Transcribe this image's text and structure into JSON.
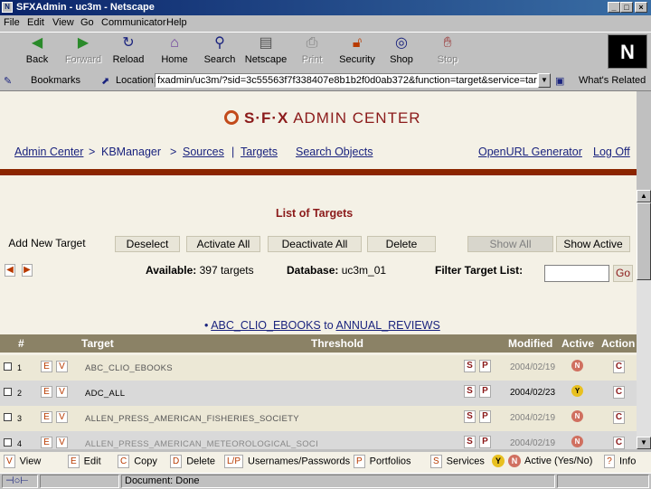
{
  "window": {
    "title": "SFXAdmin - uc3m - Netscape"
  },
  "menu": [
    "File",
    "Edit",
    "View",
    "Go",
    "Communicator",
    "Help"
  ],
  "toolbar": [
    {
      "label": "Back",
      "icon": "back-arrow-icon"
    },
    {
      "label": "Forward",
      "icon": "forward-arrow-icon",
      "disabled": true
    },
    {
      "label": "Reload",
      "icon": "reload-icon"
    },
    {
      "label": "Home",
      "icon": "home-icon"
    },
    {
      "label": "Search",
      "icon": "search-icon"
    },
    {
      "label": "Netscape",
      "icon": "netscape-icon"
    },
    {
      "label": "Print",
      "icon": "print-icon",
      "disabled": true
    },
    {
      "label": "Security",
      "icon": "lock-icon"
    },
    {
      "label": "Shop",
      "icon": "shop-icon"
    },
    {
      "label": "Stop",
      "icon": "stop-icon",
      "disabled": true
    }
  ],
  "brand_logo": "N",
  "locationbar": {
    "bookmarks": "Bookmarks",
    "location_label": "Location:",
    "url": "fxadmin/uc3m/?sid=3c55563f7f338407e8b1b2f0d0ab372&function=target&service=target_parent",
    "whats_related": "What's Related"
  },
  "header": {
    "logo_sfx": "S·F·X",
    "logo_rest": "ADMIN CENTER",
    "nav": [
      {
        "text": "Admin Center",
        "link": true
      },
      {
        "text": ">",
        "link": false
      },
      {
        "text": "KBManager",
        "link": false
      },
      {
        "text": ">",
        "link": false
      },
      {
        "text": "Sources",
        "link": true
      },
      {
        "text": "|",
        "link": false
      },
      {
        "text": "Targets",
        "link": true
      },
      {
        "text": "Search Objects",
        "link": true
      },
      {
        "text": "OpenURL Generator",
        "link": true
      },
      {
        "text": "Log Off",
        "link": true
      }
    ]
  },
  "list_title": "List of Targets",
  "actions": {
    "add_new": "Add New Target",
    "deselect": "Deselect",
    "activate_all": "Activate All",
    "deactivate_all": "Deactivate All",
    "delete": "Delete",
    "show_all": "Show All",
    "show_active": "Show Active"
  },
  "info": {
    "available_label": "Available:",
    "available_value": "397 targets",
    "database_label": "Database:",
    "database_value": "uc3m_01",
    "filter_label": "Filter Target List:",
    "filter_value": "",
    "go": "Go"
  },
  "range": {
    "bullet": "•",
    "from": "ABC_CLIO_EBOOKS",
    "to_word": "to",
    "to": "ANNUAL_REVIEWS"
  },
  "columns": [
    "#",
    "Target",
    "Threshold",
    "Modified",
    "Active",
    "Action"
  ],
  "rows": [
    {
      "num": "1",
      "target": "ABC_CLIO_EBOOKS",
      "modified": "2004/02/19",
      "active": "N",
      "action": "C"
    },
    {
      "num": "2",
      "target": "ADC_ALL",
      "modified": "2004/02/23",
      "active": "Y",
      "action": "C"
    },
    {
      "num": "3",
      "target": "ALLEN_PRESS_AMERICAN_FISHERIES_SOCIETY",
      "modified": "2004/02/19",
      "active": "N",
      "action": "C"
    },
    {
      "num": "4",
      "target": "ALLEN_PRESS_AMERICAN_METEOROLOGICAL_SOCI",
      "modified": "2004/02/19",
      "active": "N",
      "action": "C"
    }
  ],
  "legend": [
    {
      "key": "V",
      "label": "View"
    },
    {
      "key": "E",
      "label": "Edit"
    },
    {
      "key": "C",
      "label": "Copy"
    },
    {
      "key": "D",
      "label": "Delete"
    },
    {
      "key": "L/P",
      "label": "Usernames/Passwords"
    },
    {
      "key": "P",
      "label": "Portfolios"
    },
    {
      "key": "S",
      "label": "Services"
    },
    {
      "key": "Y",
      "label": ""
    },
    {
      "key": "N",
      "label": "Active (Yes/No)"
    },
    {
      "key": "?",
      "label": "Info"
    }
  ],
  "status": {
    "text": "Document: Done"
  },
  "colors": {
    "brand": "#8b1a1a",
    "accent_bar": "#8b2500",
    "header_row": "#8b8266",
    "page_bg": "#f4f1e6",
    "link": "#1a237e"
  }
}
